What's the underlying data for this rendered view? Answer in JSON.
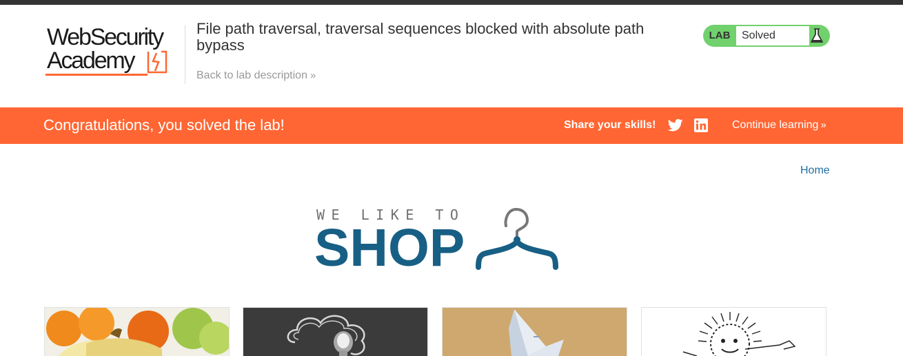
{
  "header": {
    "logo": {
      "line1": "WebSecurity",
      "line2": "Academy",
      "mark_icon": "academy-lightning-mark"
    },
    "lab_title": "File path traversal, traversal sequences blocked with absolute path bypass",
    "back_link": "Back to lab description",
    "back_chevron": "»",
    "status": {
      "label": "LAB",
      "value": "Solved",
      "icon": "flask-icon"
    }
  },
  "banner": {
    "message": "Congratulations, you solved the lab!",
    "share_label": "Share your skills!",
    "share_icons": [
      "twitter-icon",
      "linkedin-icon"
    ],
    "continue_link": "Continue learning",
    "continue_chevron": "»"
  },
  "nav": {
    "home": "Home"
  },
  "shop_logo": {
    "tagline": "WE LIKE TO",
    "word": "SHOP",
    "icon": "hanger-icon"
  },
  "colors": {
    "banner": "#ff6633",
    "status_green": "#70d16d",
    "link_blue": "#1e6ea1",
    "shop_blue": "#185f85",
    "topbar": "#333333"
  },
  "products": [
    {
      "image": "fruit-photo"
    },
    {
      "image": "chalk-lightbulb-photo"
    },
    {
      "image": "paper-boat-photo"
    },
    {
      "image": "sun-drawing"
    }
  ]
}
